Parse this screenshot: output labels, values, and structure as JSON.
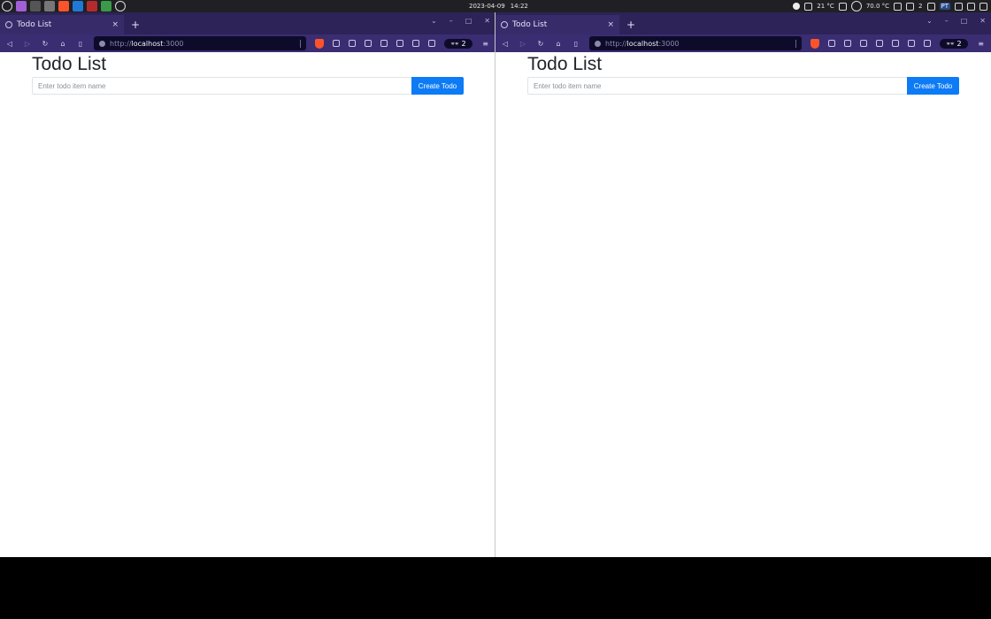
{
  "system_panel": {
    "date": "2023-04-09",
    "time": "14:22",
    "weather": "21 °C",
    "cpu_temp": "70.0 °C",
    "notif_count": "2",
    "keyboard_layout": "PT"
  },
  "colors": {
    "tabbar": "#2d2358",
    "toolbar": "#3a2d72",
    "button": "#0d7bf5"
  },
  "windows": [
    {
      "tab_title": "Todo List",
      "tab_close": "×",
      "new_tab": "+",
      "url_scheme": "http://",
      "url_host": "localhost",
      "url_port": ":3000",
      "shield_count": "2",
      "page": {
        "title": "Todo List",
        "input_placeholder": "Enter todo item name",
        "input_value": "",
        "button_label": "Create Todo"
      }
    },
    {
      "tab_title": "Todo List",
      "tab_close": "×",
      "new_tab": "+",
      "url_scheme": "http://",
      "url_host": "localhost",
      "url_port": ":3000",
      "shield_count": "2",
      "page": {
        "title": "Todo List",
        "input_placeholder": "Enter todo item name",
        "input_value": "",
        "button_label": "Create Todo"
      }
    }
  ]
}
